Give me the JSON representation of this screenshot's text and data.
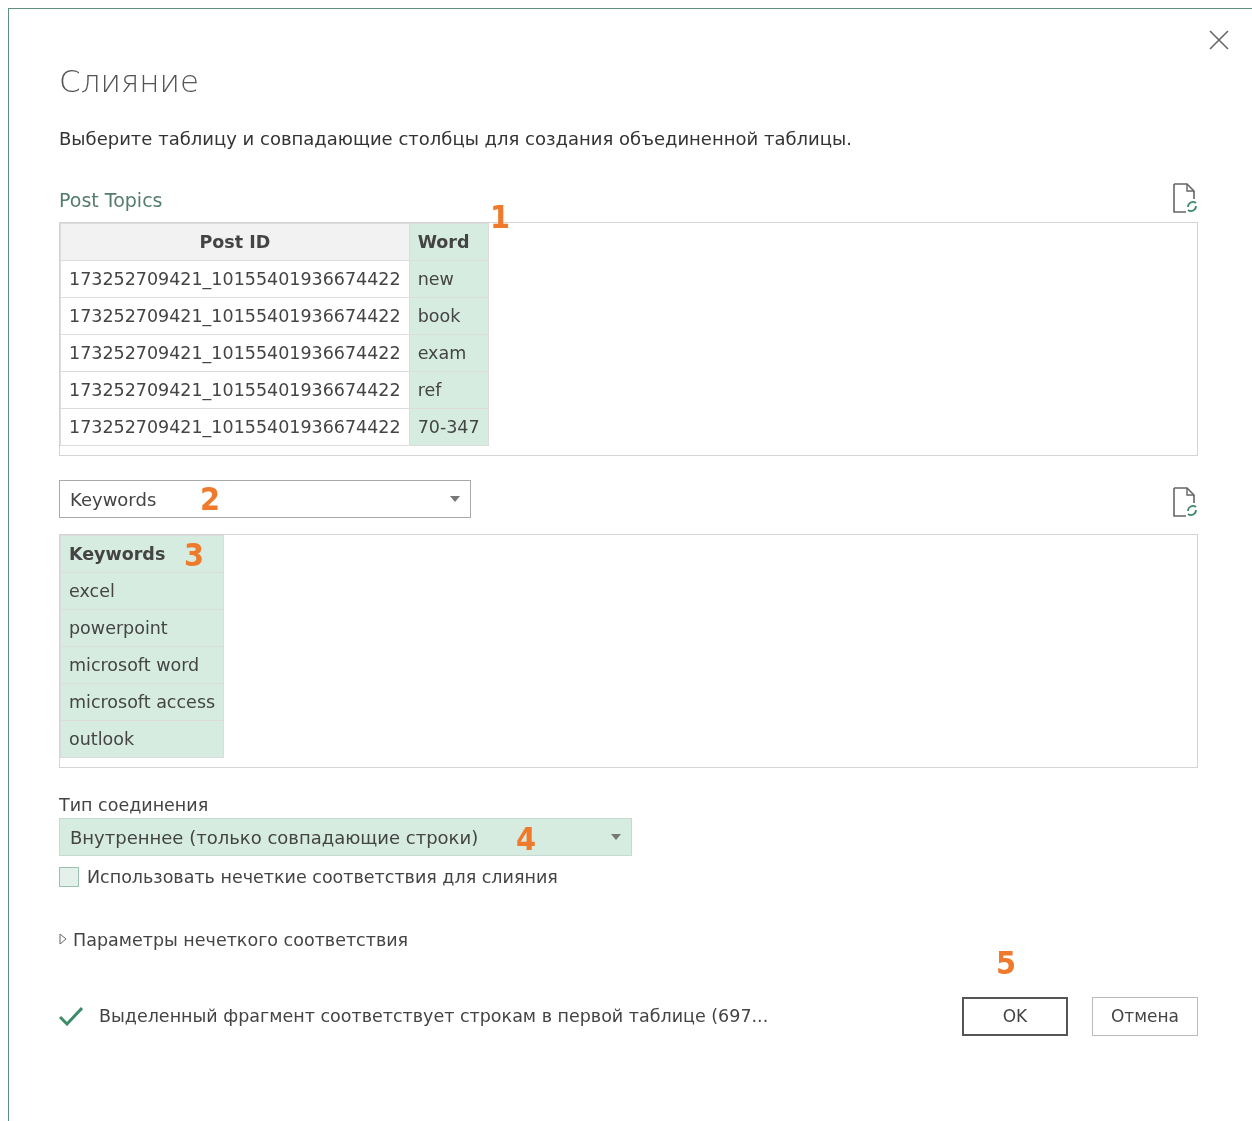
{
  "dialog": {
    "title": "Слияние",
    "description": "Выберите таблицу и совпадающие столбцы для создания объединенной таблицы."
  },
  "first_table": {
    "name": "Post Topics",
    "columns": [
      {
        "label": "Post ID",
        "selected": false
      },
      {
        "label": "Word",
        "selected": true
      }
    ],
    "rows": [
      [
        "173252709421_10155401936674422",
        "new"
      ],
      [
        "173252709421_10155401936674422",
        "book"
      ],
      [
        "173252709421_10155401936674422",
        "exam"
      ],
      [
        "173252709421_10155401936674422",
        "ref"
      ],
      [
        "173252709421_10155401936674422",
        "70-347"
      ]
    ]
  },
  "second_table": {
    "select": {
      "value": "Keywords"
    },
    "columns": [
      {
        "label": "Keywords",
        "selected": true
      }
    ],
    "rows": [
      [
        "excel"
      ],
      [
        "powerpoint"
      ],
      [
        "microsoft word"
      ],
      [
        "microsoft access"
      ],
      [
        "outlook"
      ]
    ]
  },
  "join_kind": {
    "label": "Тип соединения",
    "value": "Внутреннее (только совпадающие строки)"
  },
  "fuzzy": {
    "label": "Использовать нечеткие соответствия для слияния",
    "checked": false
  },
  "fuzzy_options": {
    "label": "Параметры нечеткого соответствия",
    "expanded": false
  },
  "status": {
    "text": "Выделенный фрагмент соответствует строкам в первой таблице (697..."
  },
  "buttons": [
    {
      "label": "OK",
      "default": true
    },
    {
      "label": "Отмена",
      "default": false
    }
  ],
  "callouts": [
    "1",
    "2",
    "3",
    "4",
    "5"
  ]
}
